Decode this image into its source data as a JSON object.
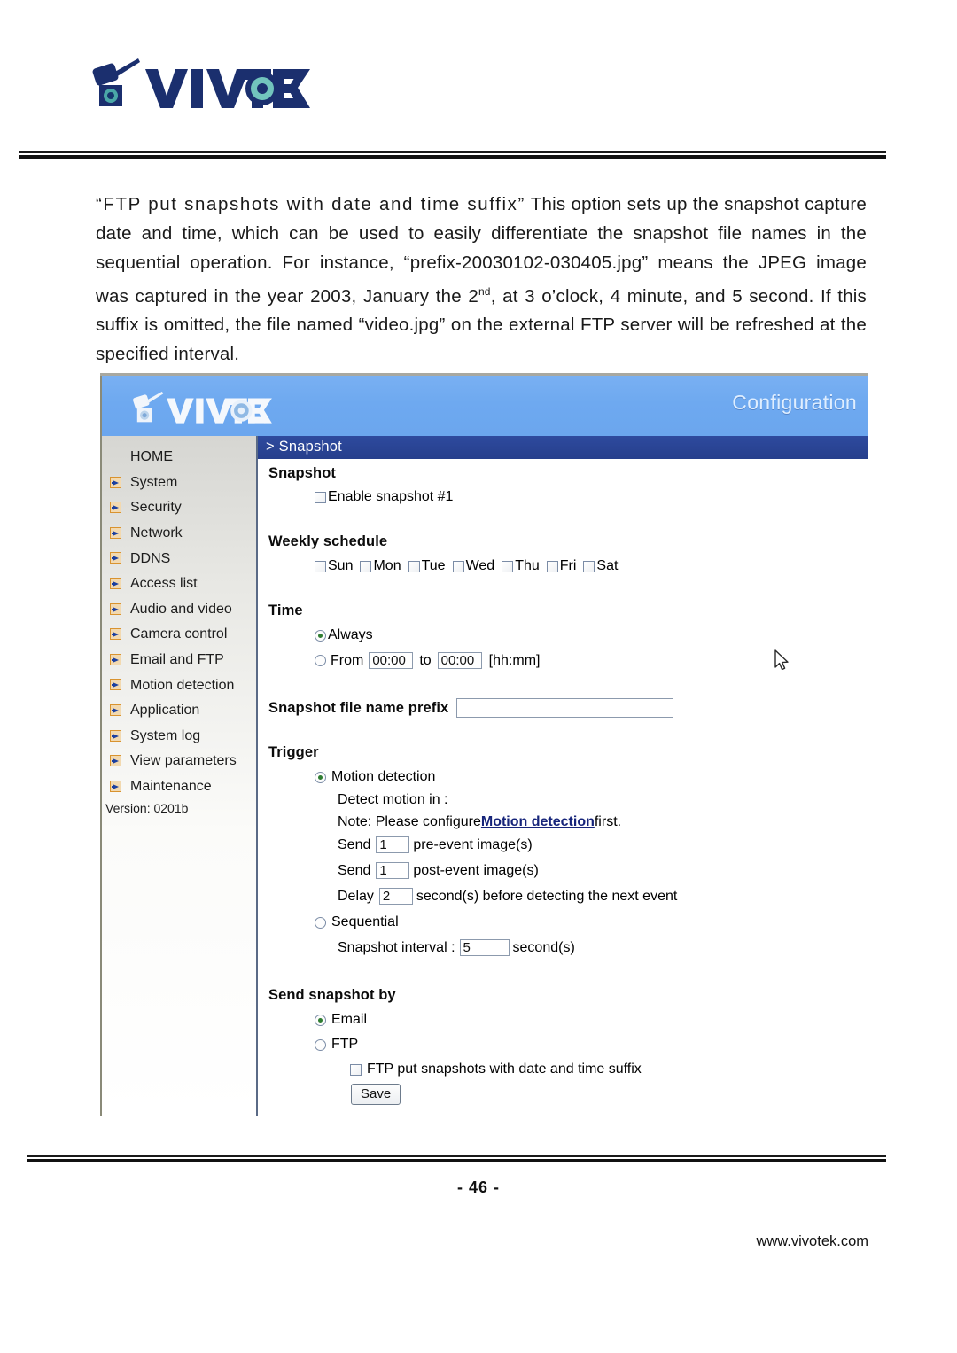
{
  "document": {
    "brand_logo": "vivotek-logo",
    "paragraph_parts": {
      "lead_quoted": "“FTP put snapshots with date and time suffix”",
      "rest": " This option sets up the snapshot capture date and time, which can be used to easily differentiate the snapshot file names in the sequential operation. For instance, “prefix-20030102-030405.jpg” means the JPEG image was captured in the year 2003, January the 2",
      "sup": "nd",
      "rest2": ", at 3 o’clock, 4 minute, and 5 second. If this suffix is omitted, the file named “video.jpg” on the external FTP server will be refreshed at the specified interval."
    },
    "page_number": "- 46 -",
    "website": "www.vivotek.com"
  },
  "screenshot": {
    "banner": {
      "logo": "vivotek-logo",
      "title": "Configuration"
    },
    "breadcrumb": "> Snapshot",
    "sidebar": {
      "items": [
        {
          "label": "HOME",
          "has_arrow": false
        },
        {
          "label": "System",
          "has_arrow": true
        },
        {
          "label": "Security",
          "has_arrow": true
        },
        {
          "label": "Network",
          "has_arrow": true
        },
        {
          "label": "DDNS",
          "has_arrow": true
        },
        {
          "label": "Access list",
          "has_arrow": true
        },
        {
          "label": "Audio and video",
          "has_arrow": true
        },
        {
          "label": "Camera control",
          "has_arrow": true
        },
        {
          "label": "Email and FTP",
          "has_arrow": true
        },
        {
          "label": "Motion detection",
          "has_arrow": true
        },
        {
          "label": "Application",
          "has_arrow": true
        },
        {
          "label": "System log",
          "has_arrow": true
        },
        {
          "label": "View parameters",
          "has_arrow": true
        },
        {
          "label": "Maintenance",
          "has_arrow": true
        }
      ],
      "version": "Version: 0201b"
    },
    "form": {
      "snapshot": {
        "heading": "Snapshot",
        "enable_label": "Enable snapshot #1",
        "enable_checked": false
      },
      "weekly_schedule": {
        "heading": "Weekly schedule",
        "days": [
          {
            "label": "Sun",
            "checked": false
          },
          {
            "label": "Mon",
            "checked": false
          },
          {
            "label": "Tue",
            "checked": false
          },
          {
            "label": "Wed",
            "checked": false
          },
          {
            "label": "Thu",
            "checked": false
          },
          {
            "label": "Fri",
            "checked": false
          },
          {
            "label": "Sat",
            "checked": false
          }
        ]
      },
      "time": {
        "heading": "Time",
        "always_label": "Always",
        "always_selected": true,
        "from_label": "From",
        "from_value": "00:00",
        "to_label": "to",
        "to_value": "00:00",
        "format_hint": "[hh:mm]"
      },
      "prefix": {
        "label": "Snapshot file name prefix",
        "value": "",
        "placeholder": ""
      },
      "trigger": {
        "heading": "Trigger",
        "motion_detection_label": "Motion detection",
        "motion_detection_selected": true,
        "detect_motion_in_label": "Detect motion in :",
        "note_prefix": "Note: Please configure ",
        "note_link": "Motion detection",
        "note_suffix": " first.",
        "pre_event": {
          "prefix": "Send",
          "value": "1",
          "suffix": "pre-event image(s)"
        },
        "post_event": {
          "prefix": "Send",
          "value": "1",
          "suffix": "post-event image(s)"
        },
        "delay": {
          "prefix": "Delay",
          "value": "2",
          "suffix": "second(s) before detecting the next event"
        },
        "sequential_label": "Sequential",
        "sequential_selected": false,
        "snapshot_interval": {
          "prefix": "Snapshot interval :",
          "value": "5",
          "suffix": "second(s)"
        }
      },
      "send_snapshot_by": {
        "heading": "Send snapshot by",
        "email_label": "Email",
        "email_selected": true,
        "ftp_label": "FTP",
        "ftp_selected": false,
        "ftp_suffix_label": "FTP put snapshots with date and time suffix",
        "ftp_suffix_checked": false,
        "save_label": "Save"
      }
    }
  },
  "colors": {
    "banner_blue": "#6ea9f0",
    "nav_dark_blue": "#2a4494",
    "link_blue": "#16247a",
    "arrow_orange": "#d9932f",
    "radio_green": "#2f7d32"
  }
}
